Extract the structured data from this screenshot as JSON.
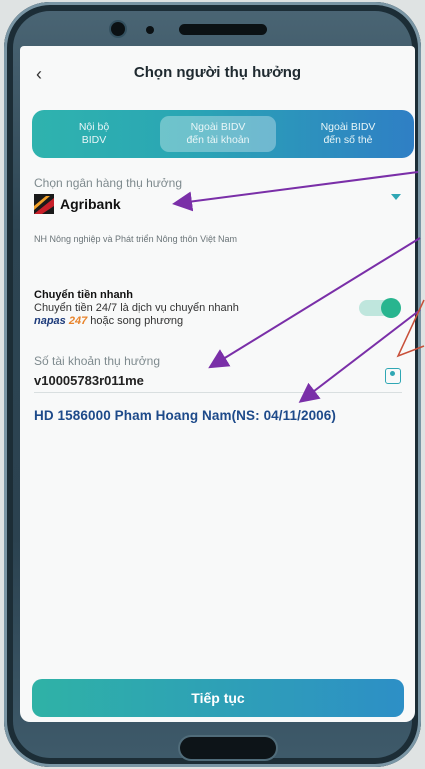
{
  "header": {
    "back_icon": "chevron-left-icon",
    "title": "Chọn người thụ hưởng"
  },
  "tabs": [
    {
      "label": "Nội bộ\nBIDV"
    },
    {
      "label": "Ngoài BIDV\nđến tài khoản",
      "selected": true
    },
    {
      "label": "Ngoài BIDV\nđến số thẻ"
    }
  ],
  "bank": {
    "label": "Chọn ngân hàng thụ hưởng",
    "name": "Agribank",
    "full_name": "NH Nông nghiệp và Phát triển Nông thôn Việt Nam"
  },
  "fast_transfer": {
    "title": "Chuyển tiền nhanh",
    "desc": "Chuyển tiền 24/7 là dịch vụ chuyển nhanh",
    "napas": "napas",
    "napas_num": "247",
    "desc_tail": " hoặc song phương",
    "enabled": true
  },
  "account": {
    "label": "Số tài khoản thụ hưởng",
    "value": "v10005783r011me"
  },
  "recipient": "HD 1586000 Pham Hoang Nam(NS: 04/11/2006)",
  "cta": "Tiếp tục",
  "colors": {
    "accent": "#2fa7b4",
    "annotation": "#7a2fa8",
    "recipient": "#1d4a8a"
  }
}
